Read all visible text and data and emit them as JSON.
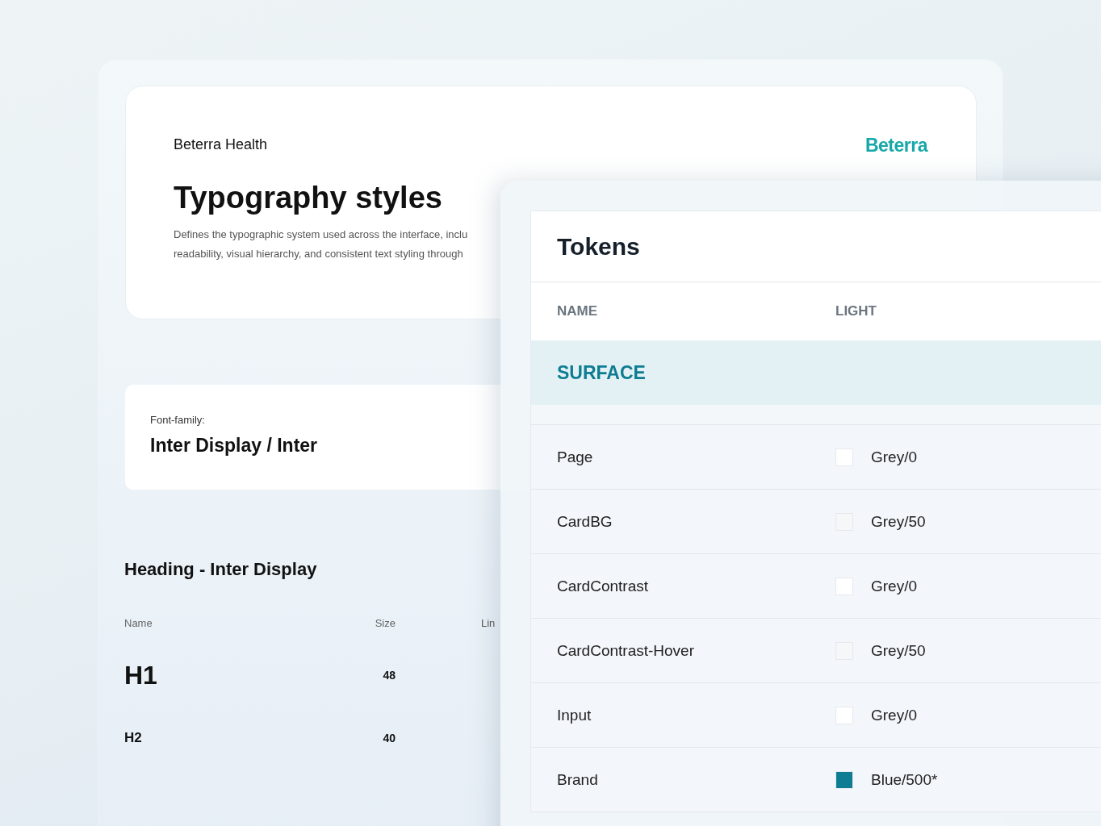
{
  "doc": {
    "brand": "Beterra Health",
    "logo": "Beterra",
    "title": "Typography styles",
    "description": "Defines the typographic system used across the interface, inclu\nreadability, visual hierarchy, and consistent text styling through",
    "font_family": {
      "label": "Font-family:",
      "value": "Inter Display / Inter"
    },
    "section": "Heading - Inter Display",
    "columns": [
      "Name",
      "Size",
      "Lin"
    ],
    "rows": [
      {
        "name": "H1",
        "size": "48",
        "kind": "h1"
      },
      {
        "name": "H2",
        "size": "40",
        "kind": "h2"
      }
    ]
  },
  "tokens": {
    "title": "Tokens",
    "columns": [
      "NAME",
      "LIGHT"
    ],
    "group": "SURFACE",
    "rows": [
      {
        "name": "Page",
        "color": "#ffffff",
        "value": "Grey/0"
      },
      {
        "name": "CardBG",
        "color": "#f6f7f9",
        "value": "Grey/50"
      },
      {
        "name": "CardContrast",
        "color": "#ffffff",
        "value": "Grey/0"
      },
      {
        "name": "CardContrast-Hover",
        "color": "#f6f7f9",
        "value": "Grey/50"
      },
      {
        "name": "Input",
        "color": "#ffffff",
        "value": "Grey/0"
      },
      {
        "name": "Brand",
        "color": "#0e7c93",
        "value": "Blue/500*"
      }
    ]
  }
}
